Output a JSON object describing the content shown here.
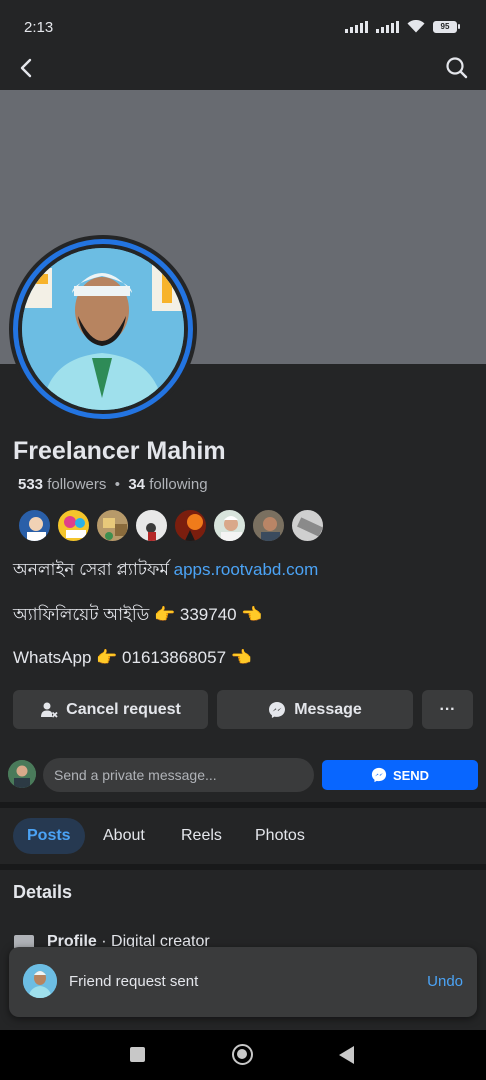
{
  "status_bar": {
    "time": "2:13",
    "battery": "95"
  },
  "profile": {
    "name": "Freelancer Mahim",
    "followers_count": "533",
    "followers_label": "followers",
    "separator": "•",
    "following_count": "34",
    "following_label": "following",
    "cover_color": "#686b71",
    "avatar_ring_color": "#2374e1"
  },
  "bio": {
    "line1_text": "অনলাইন সেরা প্ল্যাটফর্ম",
    "line1_link": "apps.rootvabd.com",
    "line2": "অ্যাফিলিয়েট আইডি 👉 339740 👈",
    "line3": "WhatsApp 👉 01613868057 👈"
  },
  "actions": {
    "cancel_request": "Cancel request",
    "message": "Message",
    "more": "···"
  },
  "private_message": {
    "placeholder": "Send a private message...",
    "send": "SEND"
  },
  "tabs": [
    "Posts",
    "About",
    "Reels",
    "Photos"
  ],
  "details": {
    "title": "Details",
    "profile_label": "Profile",
    "profile_value": " · Digital creator"
  },
  "toast": {
    "text": "Friend request sent",
    "undo": "Undo"
  },
  "colors": {
    "background": "#242526",
    "accent": "#4ba3f5",
    "send_button": "#0866ff"
  }
}
